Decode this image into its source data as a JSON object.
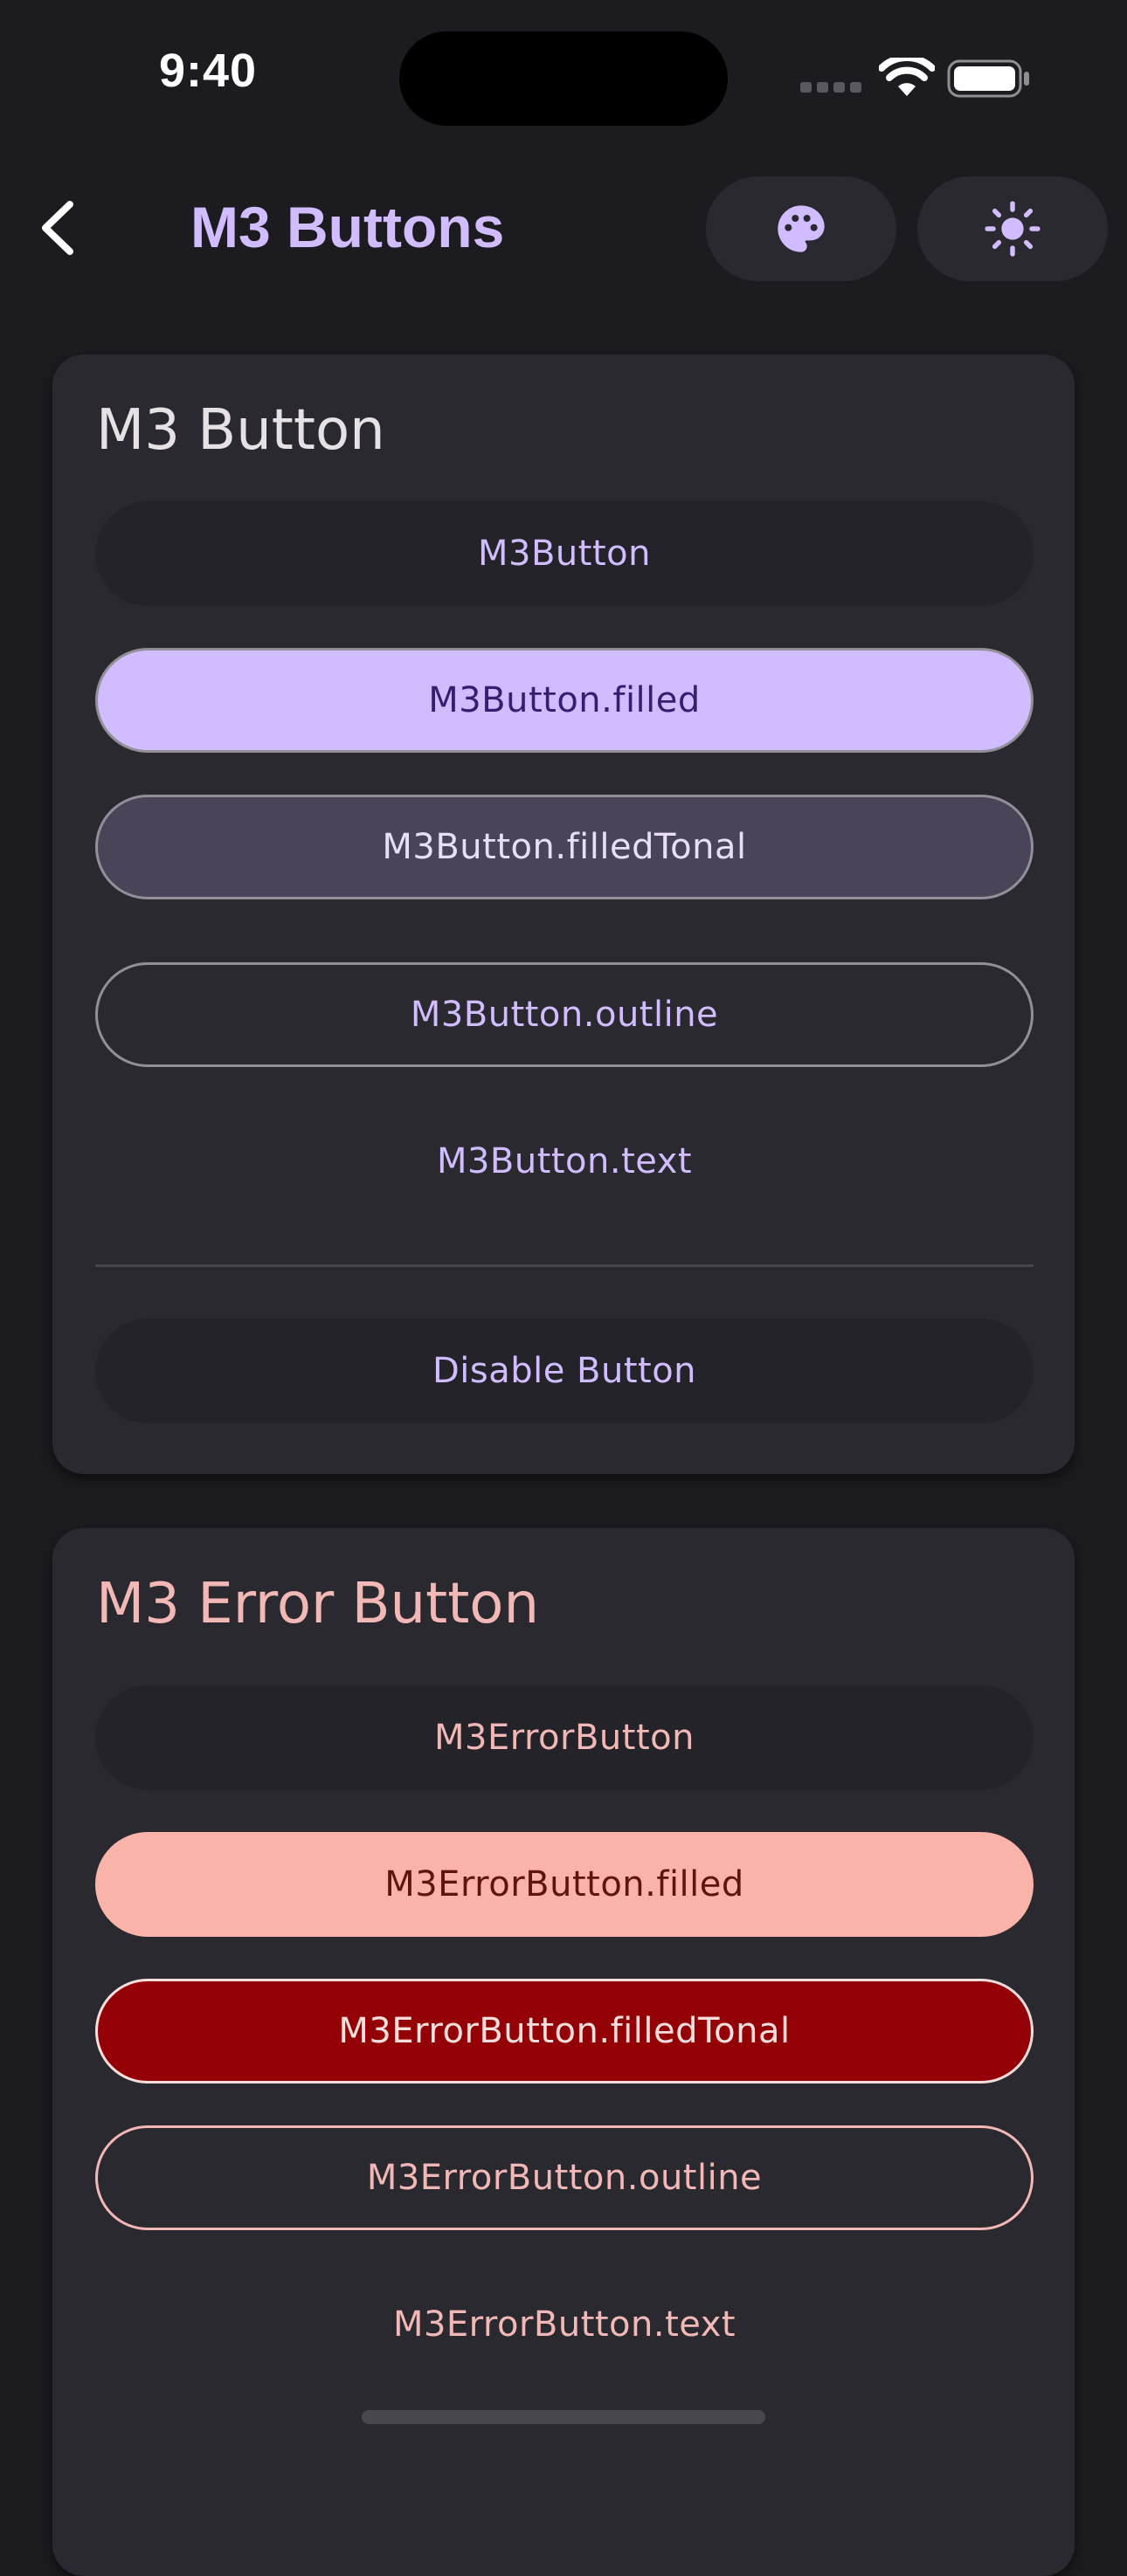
{
  "status_bar": {
    "time": "9:40"
  },
  "app_bar": {
    "title": "M3 Buttons",
    "back_icon": "chevron-left-icon",
    "actions": [
      "palette-icon",
      "brightness-icon"
    ]
  },
  "colors": {
    "background": "#1c1b1f",
    "surface": "#2b2930",
    "primary": "#d0bcff",
    "on_primary": "#381e72",
    "secondary_container": "#4a4458",
    "outline": "#938f99",
    "error": "#f2b8b5",
    "error_filled": "#f9b3a8",
    "error_container": "#930006"
  },
  "m3_button_card": {
    "title": "M3 Button",
    "buttons": {
      "elevated": "M3Button",
      "filled": "M3Button.filled",
      "filled_tonal": "M3Button.filledTonal",
      "outline": "M3Button.outline",
      "text": "M3Button.text"
    },
    "disable_button": "Disable Button"
  },
  "m3_error_button_card": {
    "title": "M3 Error Button",
    "buttons": {
      "elevated": "M3ErrorButton",
      "filled": "M3ErrorButton.filled",
      "filled_tonal": "M3ErrorButton.filledTonal",
      "outline": "M3ErrorButton.outline",
      "text": "M3ErrorButton.text"
    }
  }
}
